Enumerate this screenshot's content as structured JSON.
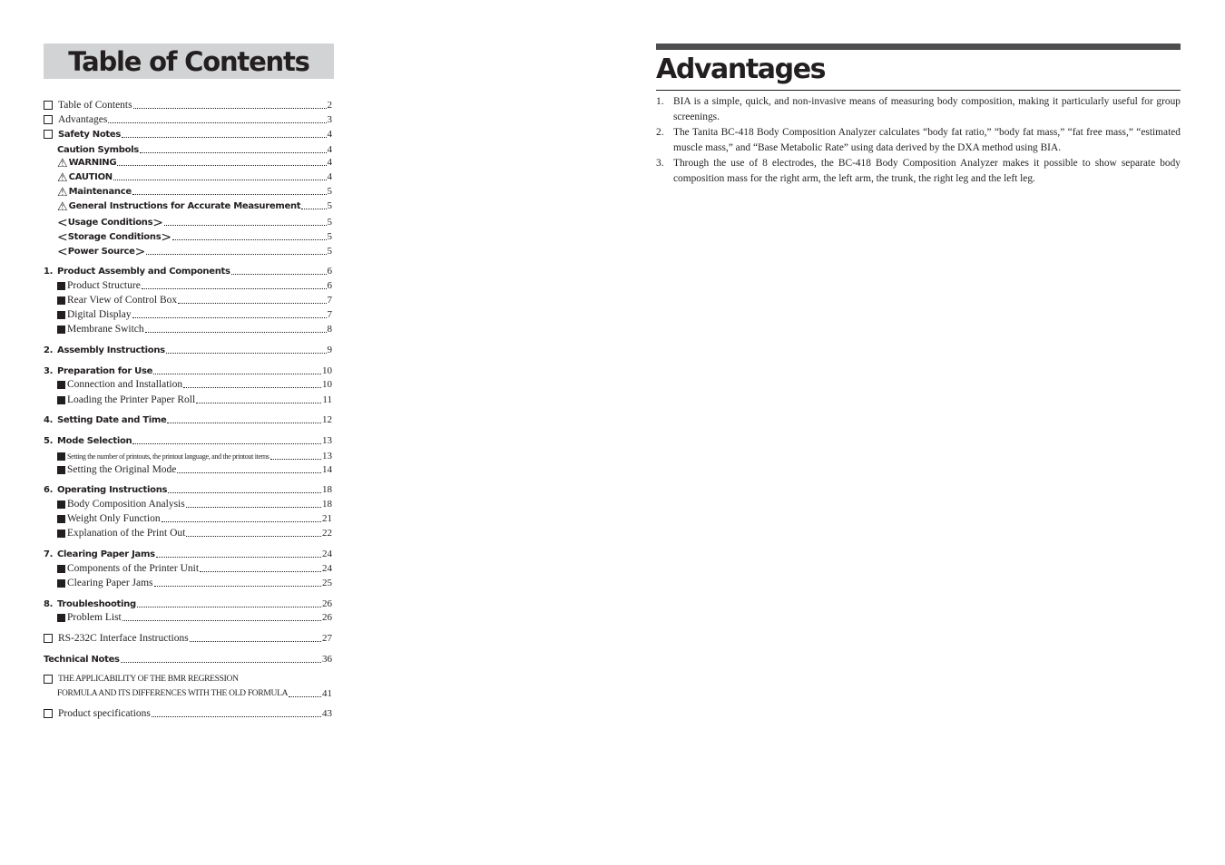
{
  "left_page": {
    "title": "Table of Contents",
    "entries": [
      {
        "marker": "checkbox",
        "style": "reg",
        "text": "Table of Contents",
        "page": "2"
      },
      {
        "marker": "checkbox",
        "style": "reg",
        "text": "Advantages",
        "page": "3"
      },
      {
        "marker": "checkbox",
        "style": "bold",
        "text": "Safety Notes",
        "page": "4"
      },
      {
        "marker": "none",
        "style": "bold",
        "indent": true,
        "text": "Caution Symbols",
        "page": "4"
      },
      {
        "marker": "warning-triangle",
        "style": "bold",
        "text": "WARNING",
        "page": "4"
      },
      {
        "marker": "warning-triangle",
        "style": "bold",
        "text": "CAUTION",
        "page": "4"
      },
      {
        "marker": "warning-triangle",
        "style": "bold",
        "text": "Maintenance",
        "page": "5"
      },
      {
        "marker": "warning-triangle",
        "style": "bold",
        "text": "General Instructions for Accurate Measurement",
        "page": "5"
      },
      {
        "marker": "angle-brackets",
        "style": "bold",
        "text": "Usage Conditions",
        "page": "5"
      },
      {
        "marker": "angle-brackets",
        "style": "bold",
        "text": "Storage Conditions",
        "page": "5"
      },
      {
        "marker": "angle-brackets",
        "style": "bold",
        "text": "Power Source",
        "page": "5"
      },
      {
        "marker": "number",
        "number": "1.",
        "style": "bold",
        "text": "Product Assembly and Components",
        "page": "6"
      },
      {
        "marker": "square",
        "style": "reg",
        "text": "Product Structure",
        "page": "6"
      },
      {
        "marker": "square",
        "style": "reg",
        "text": "Rear View of Control Box",
        "page": "7"
      },
      {
        "marker": "square",
        "style": "reg",
        "text": "Digital Display",
        "page": "7"
      },
      {
        "marker": "square",
        "style": "reg",
        "text": "Membrane Switch",
        "page": "8"
      },
      {
        "marker": "number",
        "number": "2.",
        "style": "bold",
        "text": "Assembly Instructions",
        "page": "9"
      },
      {
        "marker": "number",
        "number": "3.",
        "style": "bold",
        "text": "Preparation for Use",
        "page": "10"
      },
      {
        "marker": "square",
        "style": "reg",
        "text": "Connection and Installation",
        "page": "10"
      },
      {
        "marker": "square",
        "style": "reg",
        "text": "Loading the Printer Paper Roll",
        "page": "11"
      },
      {
        "marker": "number",
        "number": "4.",
        "style": "bold",
        "text": "Setting Date and Time",
        "page": "12"
      },
      {
        "marker": "number",
        "number": "5.",
        "style": "bold",
        "text": "Mode Selection",
        "page": "13"
      },
      {
        "marker": "square",
        "style": "tiny",
        "text": "Setting the number of printouts, the printout language, and the printout items",
        "page": "13"
      },
      {
        "marker": "square",
        "style": "reg",
        "text": "Setting the Original Mode",
        "page": "14"
      },
      {
        "marker": "number",
        "number": "6.",
        "style": "bold",
        "text": "Operating Instructions",
        "page": "18"
      },
      {
        "marker": "square",
        "style": "reg",
        "text": "Body Composition Analysis",
        "page": "18"
      },
      {
        "marker": "square",
        "style": "reg",
        "text": "Weight Only Function",
        "page": "21"
      },
      {
        "marker": "square",
        "style": "reg",
        "text": "Explanation of the Print Out",
        "page": "22"
      },
      {
        "marker": "number",
        "number": "7.",
        "style": "bold",
        "text": "Clearing Paper Jams",
        "page": "24"
      },
      {
        "marker": "square",
        "style": "reg",
        "text": "Components of the Printer Unit",
        "page": "24"
      },
      {
        "marker": "square",
        "style": "reg",
        "text": "Clearing Paper Jams",
        "page": "25"
      },
      {
        "marker": "number",
        "number": "8.",
        "style": "bold",
        "text": "Troubleshooting",
        "page": "26"
      },
      {
        "marker": "square",
        "style": "reg",
        "text": "Problem List",
        "page": "26"
      },
      {
        "marker": "checkbox",
        "style": "reg",
        "text": "RS-232C Interface Instructions",
        "page": "27"
      },
      {
        "marker": "none",
        "style": "bold",
        "text": "Technical Notes",
        "page": "36"
      },
      {
        "marker": "checkbox",
        "style": "caps",
        "text": "THE APPLICABILITY OF THE BMR REGRESSION",
        "page": ""
      },
      {
        "marker": "none",
        "style": "caps",
        "indent": true,
        "text": "FORMULA AND ITS DIFFERENCES WITH THE OLD FORMULA",
        "page": "41"
      },
      {
        "marker": "checkbox",
        "style": "reg",
        "text": "Product specifications",
        "page": "43"
      }
    ]
  },
  "right_page": {
    "title": "Advantages",
    "items": [
      {
        "number": "1.",
        "text": "BIA is a simple, quick, and non-invasive means of measuring body composition, making it particularly useful for group screenings."
      },
      {
        "number": "2.",
        "text": "The Tanita BC-418 Body Composition Analyzer calculates “body fat ratio,” “body fat mass,” “fat free mass,” “estimated muscle mass,” and “Base Metabolic Rate” using data derived by the DXA method using BIA."
      },
      {
        "number": "3.",
        "text": "Through the use of 8 electrodes, the BC-418 Body Composition Analyzer makes it possible to show separate body composition mass for the right arm, the left arm, the trunk, the right leg and the left leg."
      }
    ]
  },
  "icons": {
    "warning": "⚠",
    "angle_left": "<",
    "angle_right": ">"
  },
  "colors": {
    "text": "#231f20",
    "title_box": "#d1d3d4",
    "header_bar": "#4d4d4f"
  }
}
